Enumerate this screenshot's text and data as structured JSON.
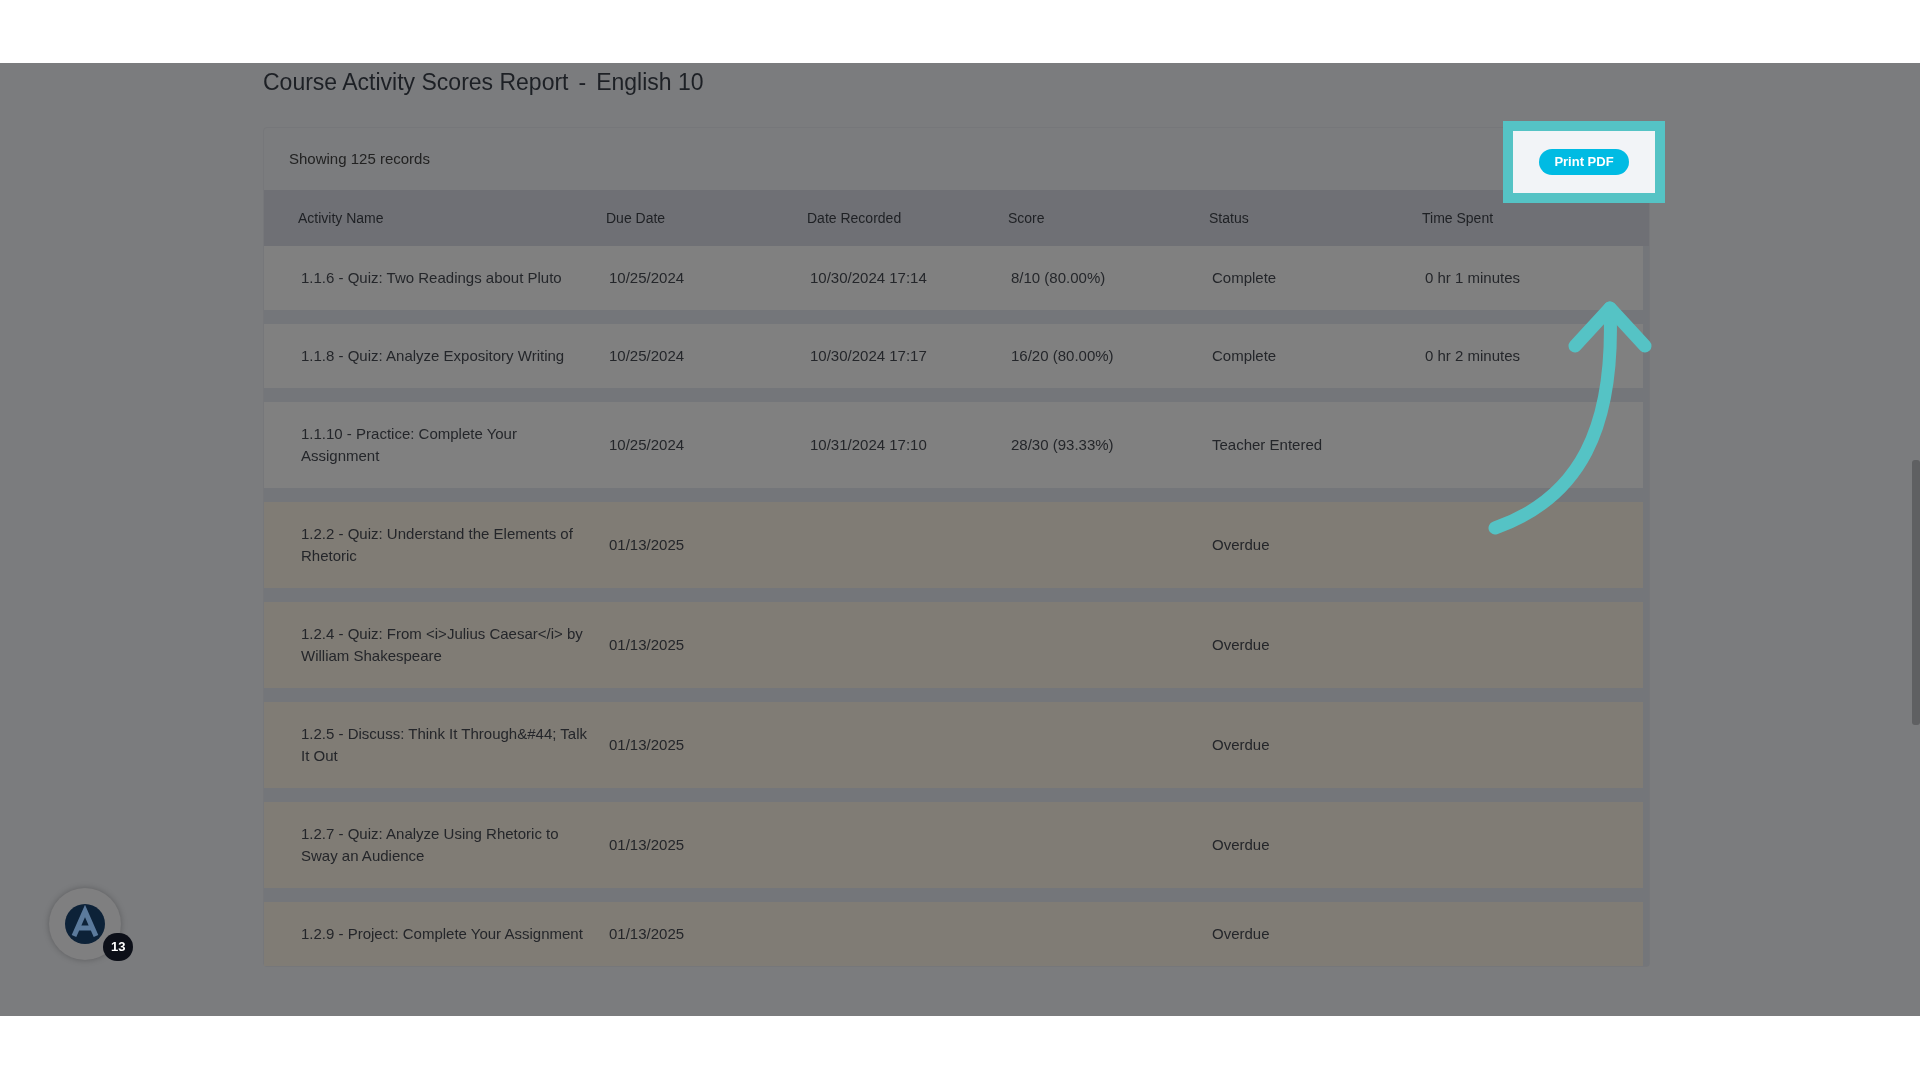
{
  "report": {
    "title": "Course Activity Scores Report",
    "separator": "-",
    "course": "English 10"
  },
  "records": "Showing 125 records",
  "print_button": "Print PDF",
  "table": {
    "columns": [
      "Activity Name",
      "Due Date",
      "Date Recorded",
      "Score",
      "Status",
      "Time Spent"
    ],
    "rows": [
      {
        "kind": "normal",
        "cells": [
          "1.1.6 - Quiz: Two Readings about Pluto",
          "10/25/2024",
          "10/30/2024 17:14",
          "8/10 (80.00%)",
          "Complete",
          "0 hr 1 minutes"
        ]
      },
      {
        "kind": "normal",
        "cells": [
          "1.1.8 - Quiz: Analyze Expository Writing",
          "10/25/2024",
          "10/30/2024 17:17",
          "16/20 (80.00%)",
          "Complete",
          "0 hr 2 minutes"
        ]
      },
      {
        "kind": "normal",
        "cells": [
          "1.1.10 - Practice: Complete Your Assignment",
          "10/25/2024",
          "10/31/2024 17:10",
          "28/30 (93.33%)",
          "Teacher Entered",
          null
        ]
      },
      {
        "kind": "overdue",
        "cells": [
          "1.2.2 - Quiz: Understand the Elements of Rhetoric",
          "01/13/2025",
          null,
          null,
          "Overdue",
          null
        ]
      },
      {
        "kind": "overdue",
        "cells": [
          "1.2.4 - Quiz: From <i>Julius Caesar</i> by William Shakespeare",
          "01/13/2025",
          null,
          null,
          "Overdue",
          null
        ]
      },
      {
        "kind": "overdue",
        "cells": [
          "1.2.5 - Discuss: Think It Through&#44; Talk It Out",
          "01/13/2025",
          null,
          null,
          "Overdue",
          null
        ]
      },
      {
        "kind": "overdue",
        "cells": [
          "1.2.7 - Quiz: Analyze Using Rhetoric to Sway an Audience",
          "01/13/2025",
          null,
          null,
          "Overdue",
          null
        ]
      },
      {
        "kind": "overdue",
        "cells": [
          "1.2.9 - Project: Complete Your Assignment",
          "01/13/2025",
          null,
          null,
          "Overdue",
          null
        ]
      }
    ]
  },
  "notification_badge": "13"
}
